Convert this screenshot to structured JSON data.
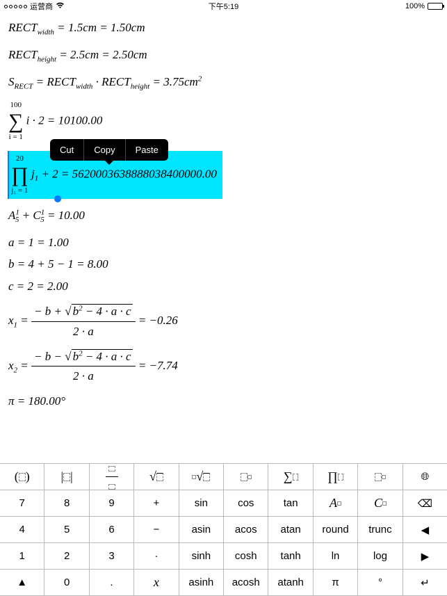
{
  "status": {
    "carrier": "运营商",
    "wifi": "wifi",
    "time": "下午5:19",
    "battery_pct": "100%"
  },
  "context_menu": {
    "cut": "Cut",
    "copy": "Copy",
    "paste": "Paste"
  },
  "equations": {
    "e1_lhs": "RECT",
    "e1_sub": "width",
    "e1_rhs": " = 1.5cm = 1.50cm",
    "e2_lhs": "RECT",
    "e2_sub": "height",
    "e2_rhs": " = 2.5cm = 2.50cm",
    "e3_a": "S",
    "e3_asub": "RECT",
    "e3_b": " = RECT",
    "e3_bsub": "width",
    "e3_c": " · RECT",
    "e3_csub": "height",
    "e3_d": " = 3.75cm",
    "e3_dsup": "2",
    "sum_top": "100",
    "sum_bot": "i = 1",
    "sum_body": " i · 2 = 10100.00",
    "prod_top": "20",
    "prod_bot": "j₁ = 1",
    "prod_body_a": " j",
    "prod_body_asub": "1",
    "prod_body_b": " + 2 = 5620003638888038400000.00",
    "ac_a": "A",
    "ac_asup": "1",
    "ac_asub": "5",
    "ac_plus": " + C",
    "ac_csup": "1",
    "ac_csub": "5",
    "ac_rhs": " = 10.00",
    "a_eq": "a = 1 = 1.00",
    "b_eq": "b = 4 + 5 − 1 = 8.00",
    "c_eq": "c = 2 = 2.00",
    "x1_lhs": "x",
    "x1_sub": "1",
    "x1_eq": " = ",
    "x1_top_a": "− b + ",
    "x1_sqrt": "b",
    "x1_sqrt_sup": "2",
    "x1_sqrt_b": " − 4 · a · c",
    "x1_bot": "2 · a",
    "x1_rhs": " = −0.26",
    "x2_lhs": "x",
    "x2_sub": "2",
    "x2_top_a": "− b − ",
    "x2_rhs": " = −7.74",
    "pi_eq": "π = 180.00°"
  },
  "keys": {
    "r1": [
      "( )",
      "[ ]",
      "frac",
      "sqrt",
      "nroot",
      "pow",
      "Σ",
      "∏",
      "sub",
      "⊕"
    ],
    "r2": [
      "7",
      "8",
      "9",
      "+",
      "sin",
      "cos",
      "tan",
      "A",
      "C",
      "⌫"
    ],
    "r3": [
      "4",
      "5",
      "6",
      "−",
      "asin",
      "acos",
      "atan",
      "round",
      "trunc",
      "◀"
    ],
    "r4": [
      "1",
      "2",
      "3",
      "·",
      "sinh",
      "cosh",
      "tanh",
      "ln",
      "log",
      "▶"
    ],
    "r5": [
      "▲",
      "0",
      ".",
      "x",
      "asinh",
      "acosh",
      "atanh",
      "π",
      "°",
      "↵"
    ]
  }
}
